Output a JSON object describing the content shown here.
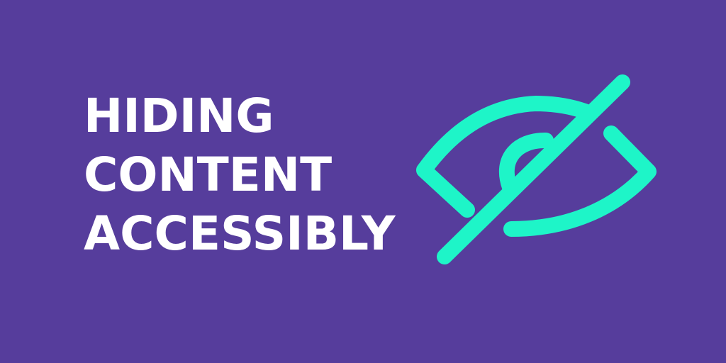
{
  "banner": {
    "title_lines": [
      "HIDING",
      "CONTENT",
      "ACCESSIBLY"
    ],
    "background_color": "#563d9c",
    "text_color": "#ffffff",
    "icon": {
      "name": "eye-slash-icon",
      "color": "#1ef5c8"
    }
  }
}
